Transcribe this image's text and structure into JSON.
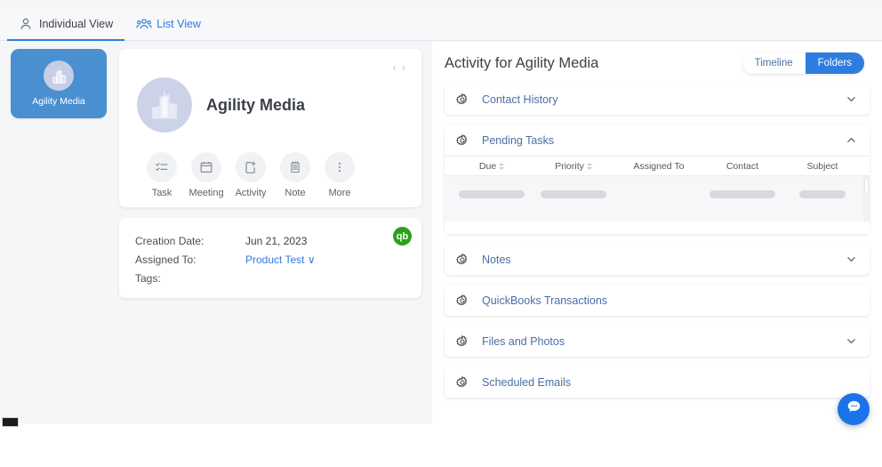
{
  "tabs": [
    {
      "label": "Individual View",
      "icon": "person-icon",
      "active": true
    },
    {
      "label": "List View",
      "icon": "people-icon",
      "active": false
    }
  ],
  "sidebar": {
    "items": [
      {
        "label": "Agility Media",
        "icon": "building-icon",
        "selected": true
      }
    ]
  },
  "profile": {
    "name": "Agility Media",
    "avatar_icon": "building-icon",
    "prev_label": "‹",
    "next_label": "›",
    "actions": [
      {
        "label": "Task",
        "icon": "task-checklist-icon"
      },
      {
        "label": "Meeting",
        "icon": "calendar-icon"
      },
      {
        "label": "Activity",
        "icon": "activity-add-icon"
      },
      {
        "label": "Note",
        "icon": "notepad-icon"
      },
      {
        "label": "More",
        "icon": "more-vertical-icon"
      }
    ]
  },
  "details": {
    "rows": [
      {
        "key": "Creation Date:",
        "value": "Jun 21, 2023",
        "link": false
      },
      {
        "key": "Assigned To:",
        "value": "Product Test ∨",
        "link": true
      },
      {
        "key": "Tags:",
        "value": "",
        "link": false
      }
    ],
    "quickbooks_badge": "qb"
  },
  "activity": {
    "title": "Activity for Agility Media",
    "toggle": [
      {
        "label": "Timeline",
        "active": false
      },
      {
        "label": "Folders",
        "active": true
      }
    ],
    "sections": [
      {
        "label": "Contact History",
        "icon": "gear-icon",
        "expanded": false,
        "chevron": "⌄"
      },
      {
        "label": "Pending Tasks",
        "icon": "gear-icon",
        "expanded": true,
        "chevron": "⌃"
      },
      {
        "label": "Notes",
        "icon": "gear-icon",
        "expanded": false,
        "chevron": "⌄"
      },
      {
        "label": "QuickBooks Transactions",
        "icon": "gear-icon",
        "expanded": false,
        "chevron": ""
      },
      {
        "label": "Files and Photos",
        "icon": "gear-icon",
        "expanded": false,
        "chevron": "⌄"
      },
      {
        "label": "Scheduled Emails",
        "icon": "gear-icon",
        "expanded": false,
        "chevron": ""
      }
    ],
    "pending_tasks_table": {
      "columns": [
        {
          "label": "Due",
          "sortable": true
        },
        {
          "label": "Priority",
          "sortable": true
        },
        {
          "label": "Assigned To",
          "sortable": false
        },
        {
          "label": "Contact",
          "sortable": false
        },
        {
          "label": "Subject",
          "sortable": false
        }
      ],
      "loading": true,
      "skeleton_widths": [
        74,
        74,
        74,
        52
      ]
    }
  },
  "chat": {
    "icon": "chat-bubble-icon"
  },
  "colors": {
    "accent_blue": "#2f7ce0",
    "sidebar_blue": "#4a90d0",
    "link_blue": "#4a6fa5",
    "quickbooks_green": "#2ca01c",
    "chat_blue": "#1a73e8",
    "page_bg": "#f5f6f7"
  }
}
